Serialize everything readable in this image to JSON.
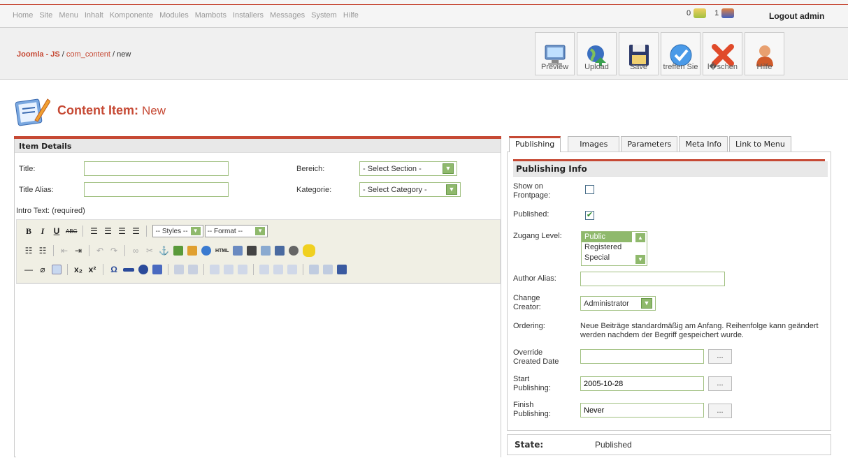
{
  "menu": [
    "Home",
    "Site",
    "Menu",
    "Inhalt",
    "Komponente",
    "Modules",
    "Mambots",
    "Installers",
    "Messages",
    "System",
    "Hilfe"
  ],
  "counters": {
    "messages": "0",
    "users": "1"
  },
  "logout": "Logout admin",
  "breadcrumb": {
    "site": "Joomla - JS",
    "sep1": " / ",
    "component": "com_content",
    "sep2": " / ",
    "task": "new"
  },
  "toolbar": [
    {
      "name": "preview",
      "label": "Preview",
      "icon": "monitor-icon"
    },
    {
      "name": "upload",
      "label": "Upload",
      "icon": "globe-icon"
    },
    {
      "name": "save",
      "label": "Save",
      "icon": "floppy-icon"
    },
    {
      "name": "apply",
      "label": "treffen Sie",
      "icon": "check-icon"
    },
    {
      "name": "delete",
      "label": "l�schen",
      "icon": "x-icon"
    },
    {
      "name": "help",
      "label": "Hilfe",
      "icon": "help-person-icon"
    }
  ],
  "header": {
    "title": "Content Item:",
    "subtitle": "New"
  },
  "item_details": {
    "heading": "Item Details",
    "title_label": "Title:",
    "title_value": "",
    "alias_label": "Title Alias:",
    "alias_value": "",
    "section_label": "Bereich:",
    "section_value": "- Select Section -",
    "category_label": "Kategorie:",
    "category_value": "- Select Category -",
    "intro_label": "Intro Text: (required)"
  },
  "editor": {
    "styles": "-- Styles --",
    "format": "-- Format --",
    "html": "HTML"
  },
  "tabs": [
    "Publishing",
    "Images",
    "Parameters",
    "Meta Info",
    "Link to Menu"
  ],
  "publishing": {
    "heading": "Publishing Info",
    "frontpage_label": "Show on Frontpage:",
    "published_label": "Published:",
    "published_checked": true,
    "frontpage_checked": false,
    "zugang_label": "Zugang Level:",
    "zugang_options": [
      "Public",
      "Registered",
      "Special"
    ],
    "author_alias_label": "Author Alias:",
    "author_alias_value": "",
    "creator_label": "Change Creator:",
    "creator_value": "Administrator",
    "ordering_label": "Ordering:",
    "ordering_text": "Neue Beiträge standardmäßig am Anfang. Reihenfolge kann geändert werden nachdem der Begriff gespeichert wurde.",
    "override_label": "Override Created Date",
    "override_value": "",
    "start_label": "Start Publishing:",
    "start_value": "2005-10-28",
    "finish_label": "Finish Publishing:",
    "finish_value": "Never",
    "date_button": "..."
  },
  "state": {
    "label": "State:",
    "value": "Published"
  },
  "colors": {
    "accent": "#c64934",
    "select_green": "#8fb96c"
  }
}
